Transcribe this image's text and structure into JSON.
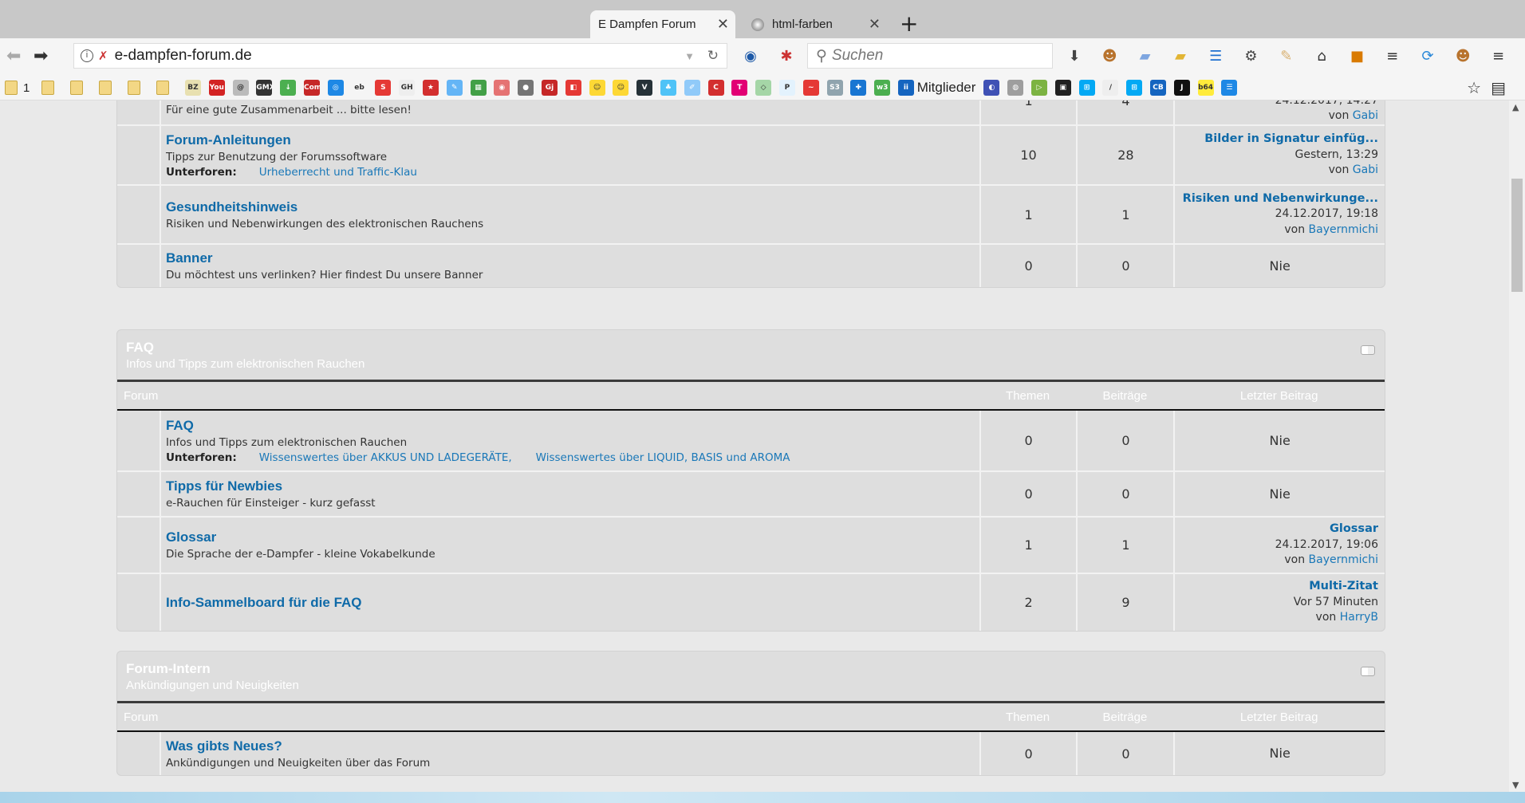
{
  "browser": {
    "tabs": [
      {
        "title": "E Dampfen Forum",
        "active": true
      },
      {
        "title": "html-farben",
        "active": false
      }
    ],
    "url": "e-dampfen-forum.de",
    "search_placeholder": "Suchen",
    "toolbar_icons": [
      "download-icon",
      "greasemonkey-icon",
      "folder-blue-icon",
      "folder-open-icon",
      "panel-icon",
      "gear-icon",
      "broom-icon",
      "home-icon",
      "orange-app-icon",
      "dark-app-icon",
      "sync-icon",
      "greasemonkey-icon",
      "menu-icon"
    ],
    "bookmark_folders": [
      "1",
      "",
      "",
      "",
      "",
      ""
    ],
    "bookmarks": [
      {
        "icon": "bz-icon",
        "color": "#e8e0b0",
        "glyph": "BZ"
      },
      {
        "icon": "youtube-icon",
        "color": "#d32323",
        "glyph": "You"
      },
      {
        "icon": "at-icon",
        "color": "#bbbbbb",
        "glyph": "@"
      },
      {
        "icon": "gmx-icon",
        "color": "#333333",
        "glyph": "GMX"
      },
      {
        "icon": "download-arrow-icon",
        "color": "#4caf50",
        "glyph": "↓"
      },
      {
        "icon": "com-icon",
        "color": "#c62828",
        "glyph": "Com"
      },
      {
        "icon": "globe-blue-icon",
        "color": "#1e88e5",
        "glyph": "◎"
      },
      {
        "icon": "ebay-icon",
        "color": "#f5f5f5",
        "glyph": "eb"
      },
      {
        "icon": "sparkasse-icon",
        "color": "#e53935",
        "glyph": "S"
      },
      {
        "icon": "gh-icon",
        "color": "#eeeeee",
        "glyph": "GH"
      },
      {
        "icon": "star-icon",
        "color": "#d32f2f",
        "glyph": "★"
      },
      {
        "icon": "feather-icon",
        "color": "#64b5f6",
        "glyph": "✎"
      },
      {
        "icon": "tiles-icon",
        "color": "#43a047",
        "glyph": "▦"
      },
      {
        "icon": "chrome-icon",
        "color": "#e57373",
        "glyph": "◉"
      },
      {
        "icon": "grey-ball-icon",
        "color": "#757575",
        "glyph": "●"
      },
      {
        "icon": "logo-red-icon",
        "color": "#c62828",
        "glyph": "Gj"
      },
      {
        "icon": "red-app-icon",
        "color": "#e53935",
        "glyph": "◧"
      },
      {
        "icon": "smiley-icon",
        "color": "#fdd835",
        "glyph": "☺"
      },
      {
        "icon": "smiley-icon",
        "color": "#fdd835",
        "glyph": "☺"
      },
      {
        "icon": "flag-icon",
        "color": "#263238",
        "glyph": "V"
      },
      {
        "icon": "palm-icon",
        "color": "#4fc3f7",
        "glyph": "♣"
      },
      {
        "icon": "notepad-icon",
        "color": "#90caf9",
        "glyph": "✐"
      },
      {
        "icon": "red-square-icon",
        "color": "#d32f2f",
        "glyph": "C"
      },
      {
        "icon": "telekom-icon",
        "color": "#e20074",
        "glyph": "T"
      },
      {
        "icon": "diamond-icon",
        "color": "#a5d6a7",
        "glyph": "◇"
      },
      {
        "icon": "p-icon",
        "color": "#e3f2fd",
        "glyph": "P"
      },
      {
        "icon": "red-circle-icon",
        "color": "#e53935",
        "glyph": "~"
      },
      {
        "icon": "s3-icon",
        "color": "#90a4ae",
        "glyph": "S3"
      },
      {
        "icon": "puzzle-icon",
        "color": "#1976d2",
        "glyph": "✚"
      },
      {
        "icon": "w3-icon",
        "color": "#4caf50",
        "glyph": "w3"
      },
      {
        "icon": "members-icon",
        "color": "#1565c0",
        "glyph": "ii",
        "label": "Mitglieder"
      },
      {
        "icon": "blue-circle-icon",
        "color": "#3f51b5",
        "glyph": "◐"
      },
      {
        "icon": "globe-icon",
        "color": "#9e9e9e",
        "glyph": "◍"
      },
      {
        "icon": "play-icon",
        "color": "#7cb342",
        "glyph": "▷"
      },
      {
        "icon": "tv-icon",
        "color": "#212121",
        "glyph": "▣"
      },
      {
        "icon": "windows-icon",
        "color": "#03a9f4",
        "glyph": "⊞"
      },
      {
        "icon": "pen-icon",
        "color": "#eeeeee",
        "glyph": "/"
      },
      {
        "icon": "windows-icon",
        "color": "#03a9f4",
        "glyph": "⊞"
      },
      {
        "icon": "cb-icon",
        "color": "#1565c0",
        "glyph": "CB"
      },
      {
        "icon": "j-icon",
        "color": "#111111",
        "glyph": "J"
      },
      {
        "icon": "b64-icon",
        "color": "#ffeb3b",
        "glyph": "b64"
      },
      {
        "icon": "panel-icon",
        "color": "#1e88e5",
        "glyph": "☰"
      }
    ]
  },
  "columns": {
    "forum": "Forum",
    "topics": "Themen",
    "posts": "Beiträge",
    "last": "Letzter Beitrag"
  },
  "labels": {
    "subforums": "Unterforen:",
    "by": "von"
  },
  "categories": [
    {
      "title": "",
      "subtitle": "",
      "forums": [
        {
          "title": "Forenregeln",
          "desc": "Für eine gute Zusammenarbeit ... bitte lesen!",
          "topics": "1",
          "posts": "4",
          "last": {
            "title": "Forenregeln",
            "date": "24.12.2017, 14:27",
            "user": "Gabi"
          }
        },
        {
          "title": "Forum-Anleitungen",
          "desc": "Tipps zur Benutzung der Forumssoftware",
          "subforums": [
            "Urheberrecht und Traffic-Klau"
          ],
          "topics": "10",
          "posts": "28",
          "last": {
            "title": "Bilder in Signatur einfüg...",
            "date": "Gestern, 13:29",
            "user": "Gabi"
          }
        },
        {
          "title": "Gesundheitshinweis",
          "desc": "Risiken und Nebenwirkungen des elektronischen Rauchens",
          "topics": "1",
          "posts": "1",
          "last": {
            "title": "Risiken und Nebenwirkunge...",
            "date": "24.12.2017, 19:18",
            "user": "Bayernmichi"
          }
        },
        {
          "title": "Banner",
          "desc": "Du möchtest uns verlinken? Hier findest Du unsere Banner",
          "topics": "0",
          "posts": "0",
          "last": {
            "none": "Nie"
          }
        }
      ]
    },
    {
      "title": "FAQ",
      "subtitle": "Infos und Tipps zum elektronischen Rauchen",
      "forums": [
        {
          "title": "FAQ",
          "desc": "Infos und Tipps zum elektronischen Rauchen",
          "subforums": [
            "Wissenswertes über AKKUS UND LADEGERÄTE,",
            "Wissenswertes über LIQUID, BASIS und AROMA"
          ],
          "topics": "0",
          "posts": "0",
          "last": {
            "none": "Nie"
          }
        },
        {
          "title": "Tipps für Newbies",
          "desc": "e-Rauchen für Einsteiger - kurz gefasst",
          "topics": "0",
          "posts": "0",
          "last": {
            "none": "Nie"
          }
        },
        {
          "title": "Glossar",
          "desc": "Die Sprache der e-Dampfer - kleine Vokabelkunde",
          "topics": "1",
          "posts": "1",
          "last": {
            "title": "Glossar",
            "date": "24.12.2017, 19:06",
            "user": "Bayernmichi"
          }
        },
        {
          "title": "Info-Sammelboard für die FAQ",
          "desc": "",
          "topics": "2",
          "posts": "9",
          "last": {
            "title": "Multi-Zitat",
            "date": "Vor 57 Minuten",
            "user": "HarryB"
          }
        }
      ]
    },
    {
      "title": "Forum-Intern",
      "subtitle": "Ankündigungen und Neuigkeiten",
      "forums": [
        {
          "title": "Was gibts Neues?",
          "desc": "Ankündigungen und Neuigkeiten über das Forum",
          "topics": "0",
          "posts": "0",
          "last": {
            "none": "Nie"
          }
        }
      ]
    }
  ]
}
